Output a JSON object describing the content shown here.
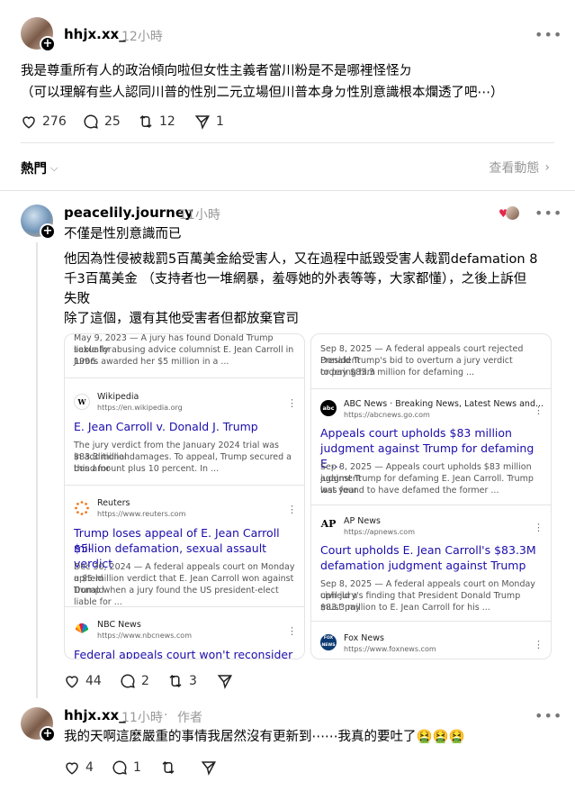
{
  "post": {
    "username": "hhjx.xx_",
    "time": "12小時",
    "line1": "我是尊重所有人的政治傾向啦但女性主義者當川粉是不是哪裡怪怪ㄉ",
    "line2": "（可以理解有些人認同川普的性別二元立場但川普本身ㄉ性別意識根本爛透了吧⋯）",
    "likes": "276",
    "comments": "25",
    "reposts": "12",
    "shares": "1"
  },
  "sort": {
    "label": "熱門",
    "activity": "查看動態"
  },
  "reply1": {
    "username": "peacelily.journey",
    "time": "11小時",
    "line1": "不僅是性別意識而已",
    "para_line1": "他因為性侵被裁罰5百萬美金給受害人，又在過程中詆毀受害人裁罰defamation 8",
    "para_line2": "千3百萬美金 （支持者也一堆網暴，羞辱她的外表等等，大家都懂），之後上訴但",
    "para_line3": "失敗",
    "line_last": "除了這個，還有其他受害者但都放棄官司",
    "likes": "44",
    "comments": "2",
    "reposts": "3"
  },
  "cards": {
    "left": {
      "top": {
        "line1": "May 9, 2023 — A jury has found Donald Trump liable for",
        "line2": "sexually abusing advice columnist E. Jean Carroll in 1996.",
        "line3": "Jurors awarded her $5 million in a ..."
      },
      "wiki": {
        "favicon": "W",
        "source": "Wikipedia",
        "url": "https://en.wikipedia.org",
        "title": "E. Jean Carroll v. Donald J. Trump",
        "line1": "The jury verdict from the January 2024 trial was $83.3 million",
        "line2": "in additional damages. To appeal, Trump secured a bond for",
        "line3": "this amount plus 10 percent. In ..."
      },
      "reuters": {
        "source": "Reuters",
        "url": "https://www.reuters.com",
        "title1": "Trump loses appeal of E. Jean Carroll $5-",
        "title2": "million defamation, sexual assault verdict",
        "line1": "Dec 30, 2024 — A federal appeals court on Monday upheld",
        "line2": "a $5-million verdict that E. Jean Carroll won against Donald",
        "line3": "Trump when a jury found the US president-elect liable for ..."
      },
      "nbc": {
        "source": "NBC News",
        "url": "https://www.nbcnews.com",
        "title": "Federal appeals court won't reconsider"
      }
    },
    "right": {
      "top": {
        "line1": "Sep 8, 2025 — A federal appeals court rejected President",
        "line2": "Donald Trump's bid to overturn a jury verdict ordering him",
        "line3": "to pay $83.3 million for defaming ..."
      },
      "abc": {
        "favicon": "abc",
        "source": "ABC News · Breaking News, Latest News and...",
        "url": "https://abcnews.go.com",
        "title1": "Appeals court upholds $83 million",
        "title2": "judgment against Trump for defaming E ...",
        "line1": "Sep 8, 2025 — Appeals court upholds $83 million judgment",
        "line2": "against Trump for defaming E. Jean Carroll. Trump last year",
        "line3": "was found to have defamed the former ..."
      },
      "ap": {
        "favicon": "AP",
        "source": "AP News",
        "url": "https://apnews.com",
        "title1": "Court upholds E. Jean Carroll's $83.3M",
        "title2": "defamation judgment against Trump",
        "line1": "Sep 8, 2025 — A federal appeals court on Monday upheld a",
        "line2": "civil jury's finding that President Donald Trump must pay",
        "line3": "$83.3 million to E. Jean Carroll for his ..."
      },
      "fox": {
        "favicon": "FOX NEWS",
        "source": "Fox News",
        "url": "https://www.foxnews.com"
      }
    }
  },
  "reply2": {
    "username": "hhjx.xx_",
    "time": "11小時",
    "author": "作者",
    "text": "我的天啊這麼嚴重的事情我居然沒有更新到⋯⋯我真的要吐了🤮🤮🤮",
    "likes": "4",
    "comments": "1"
  },
  "colors": {
    "link": "#1a0dab",
    "muted": "#999999",
    "divider": "#e4e4e4",
    "heart": "#e8264a"
  }
}
